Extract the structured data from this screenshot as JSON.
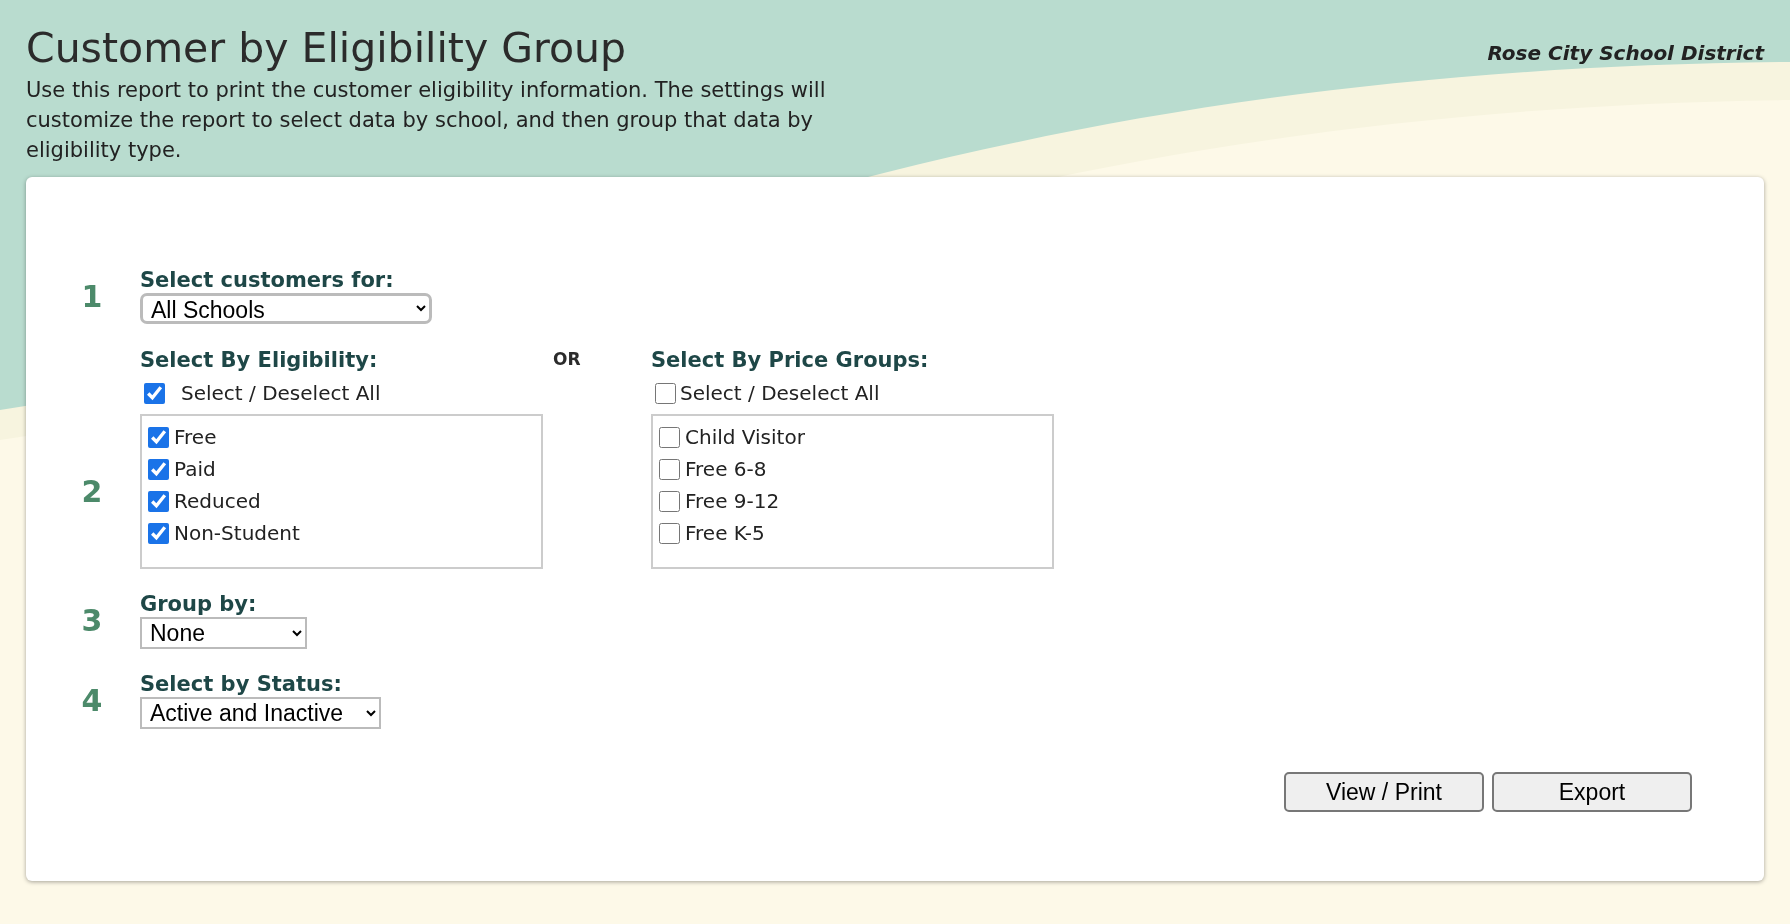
{
  "header": {
    "title": "Customer by Eligibility Group",
    "description": "Use this report to print the customer eligibility information. The settings will customize the report to select data by school, and then group that data by eligibility type.",
    "district": "Rose City School District"
  },
  "customers": {
    "step": "1",
    "label": "Select customers for:",
    "value": "All Schools"
  },
  "eligibility": {
    "step": "2",
    "label": "Select By Eligibility:",
    "select_all": {
      "label": "Select / Deselect All",
      "checked": true
    },
    "items": [
      {
        "label": "Free",
        "checked": true
      },
      {
        "label": "Paid",
        "checked": true
      },
      {
        "label": "Reduced",
        "checked": true
      },
      {
        "label": "Non-Student",
        "checked": true
      }
    ]
  },
  "separator": "OR",
  "price_groups": {
    "label": "Select By Price Groups:",
    "select_all": {
      "label": "Select / Deselect All",
      "checked": false
    },
    "items": [
      {
        "label": "Child Visitor",
        "checked": false
      },
      {
        "label": "Free 6-8",
        "checked": false
      },
      {
        "label": "Free 9-12",
        "checked": false
      },
      {
        "label": "Free K-5",
        "checked": false
      }
    ]
  },
  "group_by": {
    "step": "3",
    "label": "Group by:",
    "value": "None"
  },
  "status": {
    "step": "4",
    "label": "Select by Status:",
    "value": "Active and Inactive"
  },
  "buttons": [
    "View / Print",
    "Export"
  ]
}
